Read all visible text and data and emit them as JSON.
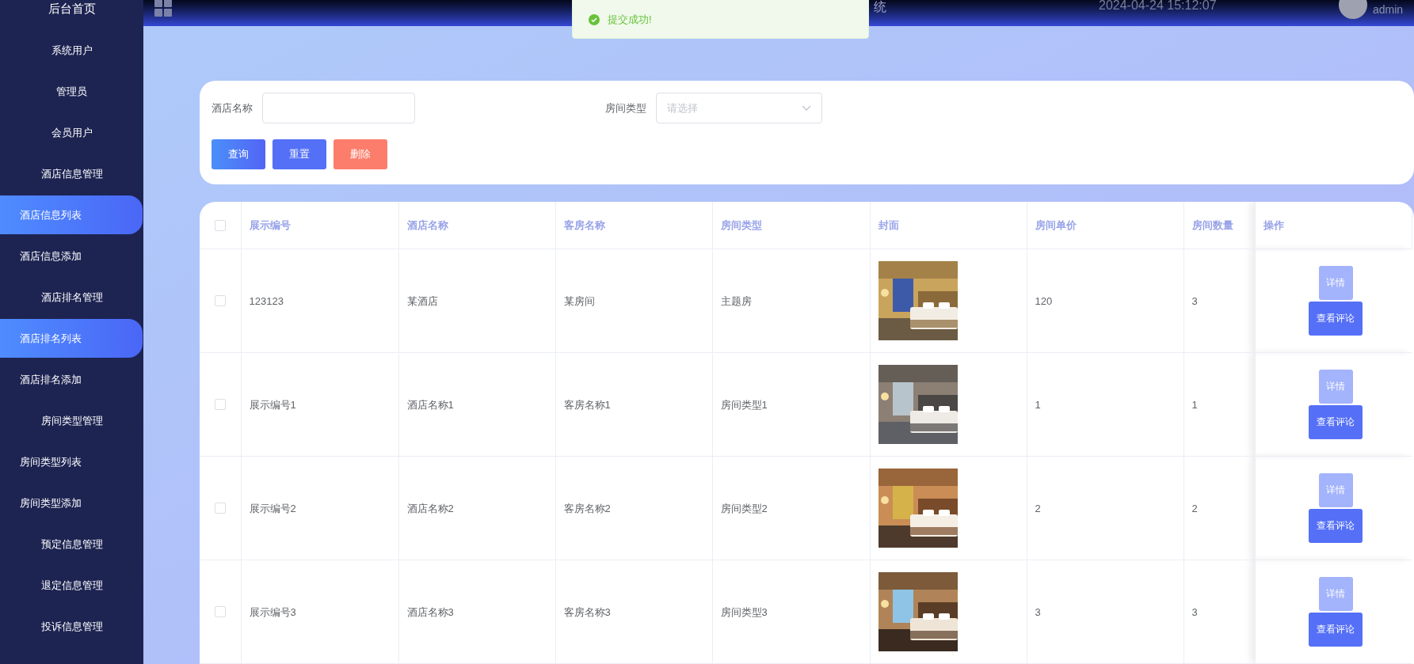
{
  "sidebar": {
    "items": [
      {
        "label": "后台首页",
        "kind": "menu",
        "selected": false
      },
      {
        "label": "系统用户",
        "kind": "menu",
        "selected": false
      },
      {
        "label": "管理员",
        "kind": "menu",
        "selected": false
      },
      {
        "label": "会员用户",
        "kind": "menu",
        "selected": false
      },
      {
        "label": "酒店信息管理",
        "kind": "menu",
        "selected": false
      },
      {
        "label": "酒店信息列表",
        "kind": "sub",
        "selected": true
      },
      {
        "label": "酒店信息添加",
        "kind": "sub",
        "selected": false
      },
      {
        "label": "酒店排名管理",
        "kind": "menu",
        "selected": false
      },
      {
        "label": "酒店排名列表",
        "kind": "sub",
        "selected": true
      },
      {
        "label": "酒店排名添加",
        "kind": "sub",
        "selected": false
      },
      {
        "label": "房间类型管理",
        "kind": "menu",
        "selected": false
      },
      {
        "label": "房间类型列表",
        "kind": "sub",
        "selected": false
      },
      {
        "label": "房间类型添加",
        "kind": "sub",
        "selected": false
      },
      {
        "label": "预定信息管理",
        "kind": "menu",
        "selected": false
      },
      {
        "label": "退定信息管理",
        "kind": "menu",
        "selected": false
      },
      {
        "label": "投诉信息管理",
        "kind": "menu",
        "selected": false
      }
    ]
  },
  "header": {
    "title": "统",
    "datetime": "2024-04-24 15:12:07",
    "user": "admin"
  },
  "toast": {
    "message": "提交成功!"
  },
  "search": {
    "fields": [
      {
        "label": "酒店名称",
        "kind": "input"
      },
      {
        "label": "房间类型",
        "kind": "select",
        "placeholder": "请选择"
      }
    ],
    "buttons": [
      {
        "label": "查询",
        "kind": "query"
      },
      {
        "label": "重置",
        "kind": "reset"
      },
      {
        "label": "删除",
        "kind": "delete"
      }
    ]
  },
  "table": {
    "select_all": {
      "checked": false
    },
    "columns": [
      "展示编号",
      "酒店名称",
      "客房名称",
      "房间类型",
      "封面",
      "房间单价",
      "房间数量",
      "操作"
    ],
    "rows": [
      {
        "checked": false,
        "cells": [
          "123123",
          "某酒店",
          "某房间",
          "主题房"
        ],
        "cover": {
          "kind": "picture"
        },
        "price": "120",
        "count": "3",
        "actions": [
          "详情",
          "查看评论"
        ]
      },
      {
        "checked": false,
        "cells": [
          "展示编号1",
          "酒店名称1",
          "客房名称1",
          "房间类型1"
        ],
        "cover": {
          "kind": "picture"
        },
        "price": "1",
        "count": "1",
        "actions": [
          "详情",
          "查看评论"
        ]
      },
      {
        "checked": false,
        "cells": [
          "展示编号2",
          "酒店名称2",
          "客房名称2",
          "房间类型2"
        ],
        "cover": {
          "kind": "picture"
        },
        "price": "2",
        "count": "2",
        "actions": [
          "详情",
          "查看评论"
        ]
      },
      {
        "checked": false,
        "cells": [
          "展示编号3",
          "酒店名称3",
          "客房名称3",
          "房间类型3"
        ],
        "cover": {
          "kind": "picture"
        },
        "price": "3",
        "count": "3",
        "actions": [
          "详情",
          "查看评论"
        ]
      }
    ]
  }
}
